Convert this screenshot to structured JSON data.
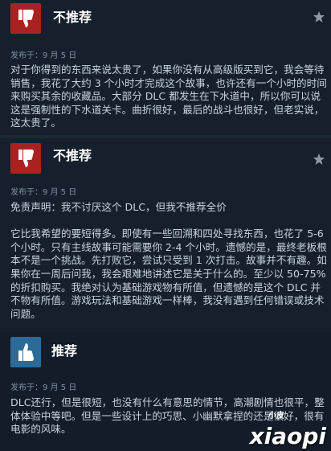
{
  "reviews": [
    {
      "verdict": "不推荐",
      "type": "negative",
      "posted": "发布于：9 月 5 日",
      "body": "对于你得到的东西来说太贵了，如果你没有从高级版买到它，我会等待销售，我花了大约 3 个小时才完成这个故事，也许还有一个小时的时间来购买其余的收藏品。大部分 DLC 都发生在下水道中，所以你可以说这是强制性的下水道关卡。曲折很好，最后的战斗也很好，但老实说，这太贵了。"
    },
    {
      "verdict": "不推荐",
      "type": "negative",
      "posted": "发布于：9 月 5 日",
      "body": "免责声明：我不讨厌这个 DLC，但我不推荐全价\n\n它比我希望的要短得多。即使有一些回溯和四处寻找东西，也花了 5-6 个小时。只有主线故事可能需要你 2-4 个小时。遗憾的是，最终老板根本不是一个挑战。先打败它，尝试只受到 1 次打击。故事并不有趣。如果你在一周后问我，我会艰难地讲述它是关于什么的。至少以 50-75% 的折扣购买。我绝对认为基础游戏物有所值，但遗憾的是这个 DLC 并不物有所值。游戏玩法和基础游戏一样棒，我没有遇到任何错误或技术问题。"
    },
    {
      "verdict": "推荐",
      "type": "positive",
      "posted": "发布于：9 月 5 日",
      "body": "DLC还行，但是很短，也没有什么有意思的情节，高潮剧情也很平，整体体验中等吧。但是一些设计上的巧思、小幽默拿捏的还是很好，很有电影的风味。"
    }
  ],
  "watermark": {
    "brand": "xiaopi",
    "small": "小皮"
  }
}
